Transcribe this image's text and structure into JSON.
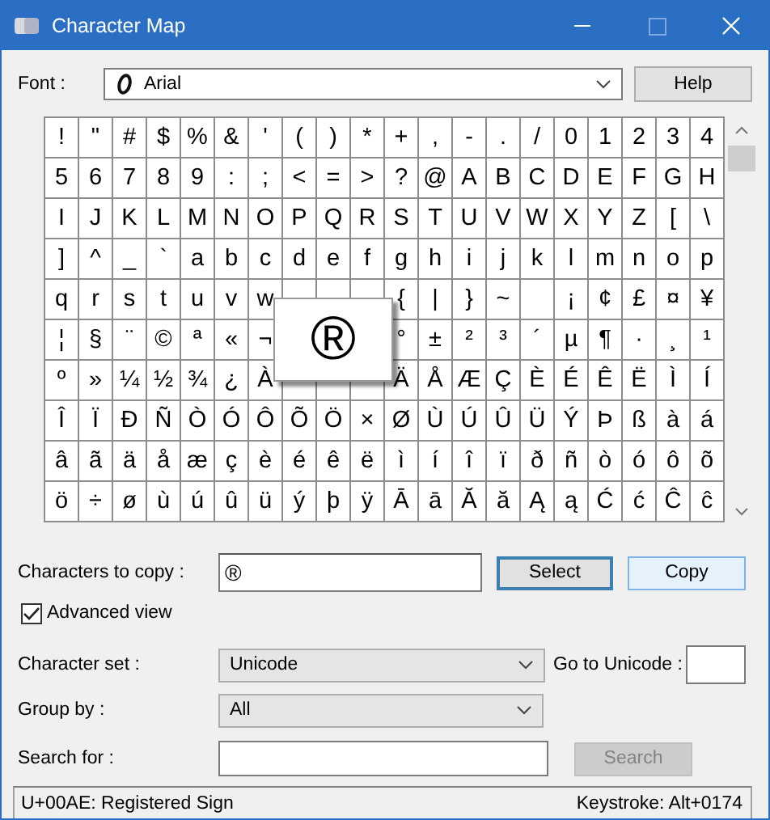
{
  "window": {
    "title": "Character Map"
  },
  "font": {
    "label": "Font :",
    "value": "Arial"
  },
  "help_button": "Help",
  "grid": {
    "rows": [
      [
        "!",
        "\"",
        "#",
        "$",
        "%",
        "&",
        "'",
        "(",
        ")",
        "*",
        "+",
        ",",
        "-",
        ".",
        "/",
        "0",
        "1",
        "2",
        "3",
        "4"
      ],
      [
        "5",
        "6",
        "7",
        "8",
        "9",
        ":",
        ";",
        "<",
        "=",
        ">",
        "?",
        "@",
        "A",
        "B",
        "C",
        "D",
        "E",
        "F",
        "G",
        "H"
      ],
      [
        "I",
        "J",
        "K",
        "L",
        "M",
        "N",
        "O",
        "P",
        "Q",
        "R",
        "S",
        "T",
        "U",
        "V",
        "W",
        "X",
        "Y",
        "Z",
        "[",
        "\\"
      ],
      [
        "]",
        "^",
        "_",
        "`",
        "a",
        "b",
        "c",
        "d",
        "e",
        "f",
        "g",
        "h",
        "i",
        "j",
        "k",
        "l",
        "m",
        "n",
        "o",
        "p"
      ],
      [
        "q",
        "r",
        "s",
        "t",
        "u",
        "v",
        "w",
        null,
        null,
        null,
        "{",
        "|",
        "}",
        "~",
        null,
        "¡",
        "¢",
        "£",
        "¤",
        "¥"
      ],
      [
        "¦",
        "§",
        "¨",
        "©",
        "ª",
        "«",
        "¬",
        null,
        null,
        null,
        "°",
        "±",
        "²",
        "³",
        "´",
        "µ",
        "¶",
        "·",
        "¸",
        "¹"
      ],
      [
        "º",
        "»",
        "¼",
        "½",
        "¾",
        "¿",
        "À",
        null,
        null,
        null,
        "Ä",
        "Å",
        "Æ",
        "Ç",
        "È",
        "É",
        "Ê",
        "Ë",
        "Ì",
        "Í"
      ],
      [
        "Î",
        "Ï",
        "Ð",
        "Ñ",
        "Ò",
        "Ó",
        "Ô",
        "Õ",
        "Ö",
        "×",
        "Ø",
        "Ù",
        "Ú",
        "Û",
        "Ü",
        "Ý",
        "Þ",
        "ß",
        "à",
        "á"
      ],
      [
        "â",
        "ã",
        "ä",
        "å",
        "æ",
        "ç",
        "è",
        "é",
        "ê",
        "ë",
        "ì",
        "í",
        "î",
        "ï",
        "ð",
        "ñ",
        "ò",
        "ó",
        "ô",
        "õ"
      ],
      [
        "ö",
        "÷",
        "ø",
        "ù",
        "ú",
        "û",
        "ü",
        "ý",
        "þ",
        "ÿ",
        "Ā",
        "ā",
        "Ă",
        "ă",
        "Ą",
        "ą",
        "Ć",
        "ć",
        "Ĉ",
        "ĉ"
      ]
    ],
    "magnified": "®"
  },
  "copy": {
    "label": "Characters to copy :",
    "value": "®"
  },
  "select_button": "Select",
  "copy_button": "Copy",
  "advanced_view": {
    "label": "Advanced view",
    "checked": true
  },
  "character_set": {
    "label": "Character set :",
    "value": "Unicode"
  },
  "go_to_unicode": {
    "label": "Go to Unicode :"
  },
  "group_by": {
    "label": "Group by :",
    "value": "All"
  },
  "search": {
    "label": "Search for :",
    "button": "Search",
    "disabled": true
  },
  "status_bar": {
    "description": "U+00AE: Registered Sign",
    "keystroke": "Keystroke: Alt+0174"
  }
}
